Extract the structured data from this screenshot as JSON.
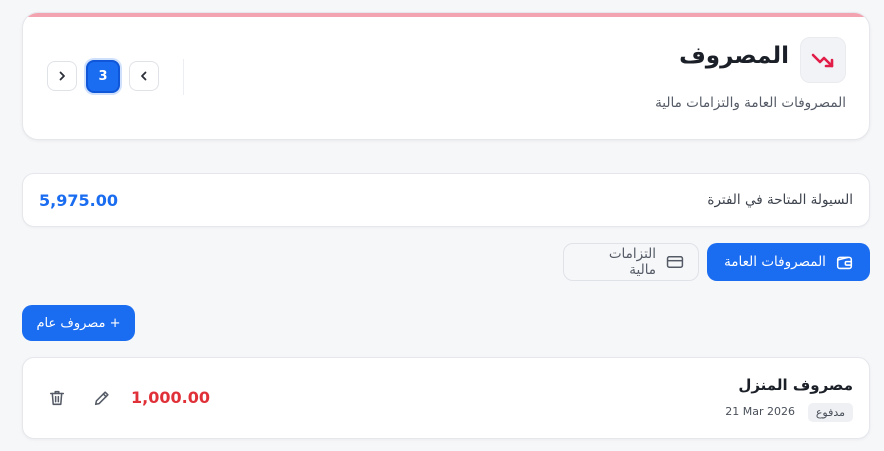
{
  "header": {
    "title": "المصروف",
    "subtitle": "المصروفات العامة والتزامات مالية",
    "icon": "trending-down-icon",
    "accent_color": "#e11d48"
  },
  "pager": {
    "current_page": "3",
    "prev_icon": "chevron-left-icon",
    "next_icon": "chevron-right-icon"
  },
  "balance": {
    "label": "السيولة المتاحة في الفترة",
    "value": "5,975.00",
    "color": "#1a6cf0"
  },
  "tabs": [
    {
      "label": "المصروفات العامة",
      "icon": "wallet-icon",
      "active": true
    },
    {
      "label": "التزامات مالية",
      "icon": "credit-card-icon",
      "active": false
    }
  ],
  "add_button": {
    "label": "+ مصروف عام"
  },
  "expenses": [
    {
      "title": "مصروف المنزل",
      "status": "مدفوع",
      "date": "21 Mar 2026",
      "amount": "1,000.00",
      "amount_color": "#e03139"
    }
  ]
}
